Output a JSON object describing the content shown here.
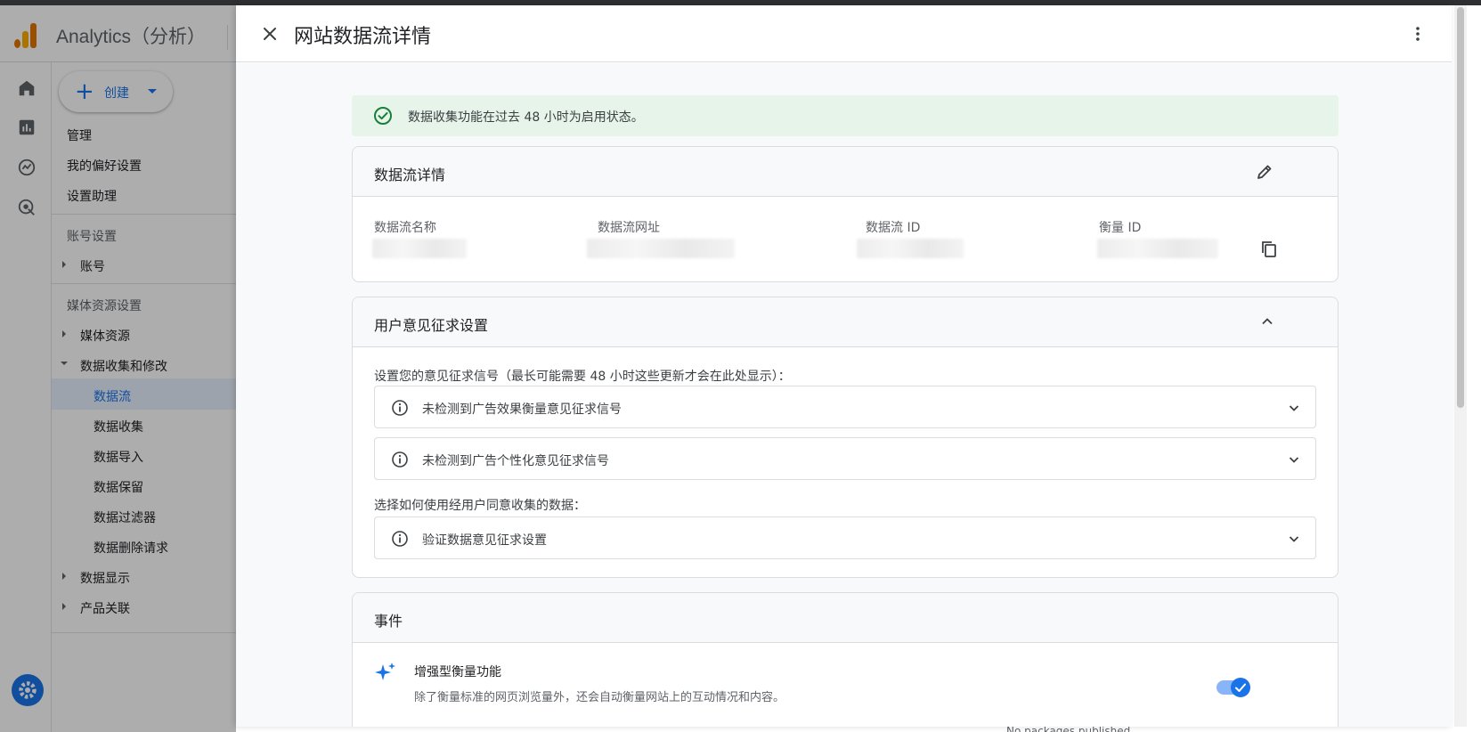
{
  "app": {
    "name": "Analytics（分析）",
    "create_label": "创建"
  },
  "sidebar": {
    "items": [
      {
        "label": "管理"
      },
      {
        "label": "我的偏好设置"
      },
      {
        "label": "设置助理"
      }
    ],
    "account_section": "账号设置",
    "account_item": "账号",
    "property_section": "媒体资源设置",
    "property_items": [
      {
        "label": "媒体资源"
      },
      {
        "label": "数据收集和修改"
      }
    ],
    "sub_items": [
      {
        "label": "数据流"
      },
      {
        "label": "数据收集"
      },
      {
        "label": "数据导入"
      },
      {
        "label": "数据保留"
      },
      {
        "label": "数据过滤器"
      },
      {
        "label": "数据删除请求"
      }
    ],
    "tail_items": [
      {
        "label": "数据显示"
      },
      {
        "label": "产品关联"
      }
    ]
  },
  "background": {
    "bottom_text": "No packages published"
  },
  "dialog": {
    "title": "网站数据流详情",
    "banner": "数据收集功能在过去 48 小时为启用状态。",
    "stream_details": {
      "title": "数据流详情",
      "fields": [
        {
          "label": "数据流名称"
        },
        {
          "label": "数据流网址"
        },
        {
          "label": "数据流 ID"
        },
        {
          "label": "衡量 ID"
        }
      ]
    },
    "consent": {
      "title": "用户意见征求设置",
      "intro": "设置您的意见征求信号（最长可能需要 48 小时这些更新才会在此处显示）：",
      "items": [
        {
          "label": "未检测到广告效果衡量意见征求信号"
        },
        {
          "label": "未检测到广告个性化意见征求信号"
        }
      ],
      "usage_label": "选择如何使用经用户同意收集的数据：",
      "verify_item": "验证数据意见征求设置"
    },
    "events": {
      "title": "事件",
      "enhanced_title": "增强型衡量功能",
      "enhanced_desc": "除了衡量标准的网页浏览量外，还会自动衡量网站上的互动情况和内容。",
      "enhanced_enabled": true
    }
  },
  "colors": {
    "accent": "#1a73e8",
    "banner_bg": "#e6f4ea",
    "success": "#188038",
    "logo_orange": "#f9ab00",
    "logo_dark": "#e37400"
  }
}
